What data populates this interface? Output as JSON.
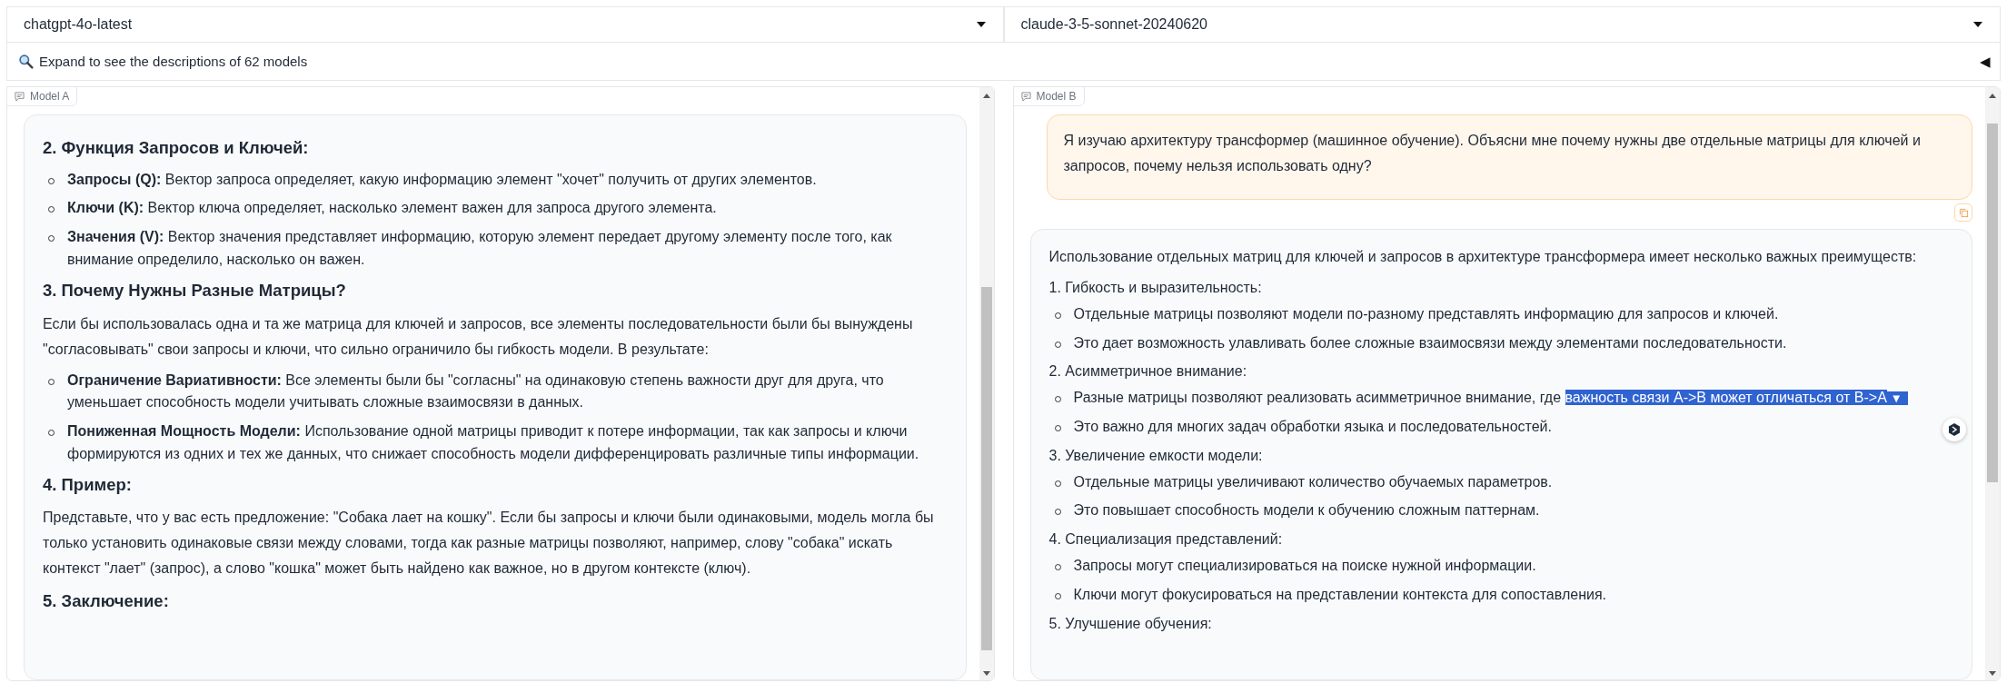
{
  "model_selectors": [
    {
      "value": "chatgpt-4o-latest"
    },
    {
      "value": "claude-3-5-sonnet-20240620"
    }
  ],
  "expand_bar": {
    "label": "Expand to see the descriptions of 62 models",
    "toggle": "◀"
  },
  "panels": [
    {
      "label": "Model A",
      "messages": [
        {
          "kind": "assistant",
          "blocks": [
            {
              "kind": "heading",
              "text": "2. Функция Запросов и Ключей:"
            },
            {
              "kind": "bullet",
              "text": "**Запросы (Q):** Вектор запроса определяет, какую информацию элемент \"хочет\" получить от других элементов."
            },
            {
              "kind": "bullet",
              "text": "**Ключи (K):** Вектор ключа определяет, насколько элемент важен для запроса другого элемента."
            },
            {
              "kind": "bullet",
              "text": "**Значения (V):** Вектор значения представляет информацию, которую элемент передает другому элементу после того, как внимание определило, насколько он важен."
            },
            {
              "kind": "heading",
              "text": "3. Почему Нужны Разные Матрицы?"
            },
            {
              "kind": "paragraph",
              "text": "Если бы использовалась одна и та же матрица для ключей и запросов, все элементы последовательности были бы вынуждены \"согласовывать\" свои запросы и ключи, что сильно ограничило бы гибкость модели. В результате:"
            },
            {
              "kind": "bullet",
              "text": "**Ограничение Вариативности:** Все элементы были бы \"согласны\" на одинаковую степень важности друг для друга, что уменьшает способность модели учитывать сложные взаимосвязи в данных."
            },
            {
              "kind": "bullet",
              "text": "**Пониженная Мощность Модели:** Использование одной матрицы приводит к потере информации, так как запросы и ключи формируются из одних и тех же данных, что снижает способность модели дифференцировать различные типы информации."
            },
            {
              "kind": "heading",
              "text": "4. Пример:"
            },
            {
              "kind": "paragraph",
              "text": "Представьте, что у вас есть предложение: \"Собака лает на кошку\". Если бы запросы и ключи были одинаковыми, модель могла бы только установить одинаковые связи между словами, тогда как разные матрицы позволяют, например, слову \"собака\" искать контекст \"лает\" (запрос), а слово \"кошка\" может быть найдено как важное, но в другом контексте (ключ)."
            },
            {
              "kind": "heading",
              "text": "5. Заключение:"
            }
          ]
        }
      ]
    },
    {
      "label": "Model B",
      "messages": [
        {
          "kind": "user",
          "blocks": [
            {
              "kind": "paragraph",
              "text": "Я изучаю архитектуру трансформер (машинное обучение). Объясни мне почему нужны две отдельные матрицы для ключей и запросов, почему нельзя использовать одну?"
            }
          ]
        },
        {
          "kind": "assistant",
          "blocks": [
            {
              "kind": "paragraph",
              "text": "Использование отдельных матриц для ключей и запросов в архитектуре трансформера имеет несколько важных преимуществ:"
            },
            {
              "kind": "line",
              "text": "1. Гибкость и выразительность:"
            },
            {
              "kind": "bullet",
              "text": "Отдельные матрицы позволяют модели по-разному представлять информацию для запросов и ключей."
            },
            {
              "kind": "bullet",
              "text": "Это дает возможность улавливать более сложные взаимосвязи между элементами последовательности."
            },
            {
              "kind": "line",
              "text": "2. Асимметричное внимание:"
            },
            {
              "kind": "bullet",
              "text": "Разные матрицы позволяют реализовать асимметричное внимание, где",
              "selection": "важность связи A->B может отличаться от B->A",
              "selection_menu": "▼"
            },
            {
              "kind": "bullet",
              "text": "Это важно для многих задач обработки языка и последовательностей."
            },
            {
              "kind": "line",
              "text": "3. Увеличение емкости модели:"
            },
            {
              "kind": "bullet",
              "text": "Отдельные матрицы увеличивают количество обучаемых параметров."
            },
            {
              "kind": "bullet",
              "text": "Это повышает способность модели к обучению сложным паттернам."
            },
            {
              "kind": "line",
              "text": "4. Специализация представлений:"
            },
            {
              "kind": "bullet",
              "text": "Запросы могут специализироваться на поиске нужной информации."
            },
            {
              "kind": "bullet",
              "text": "Ключи могут фокусироваться на представлении контекста для сопоставления."
            },
            {
              "kind": "line",
              "text": "5. Улучшение обучения:"
            }
          ]
        }
      ]
    }
  ]
}
